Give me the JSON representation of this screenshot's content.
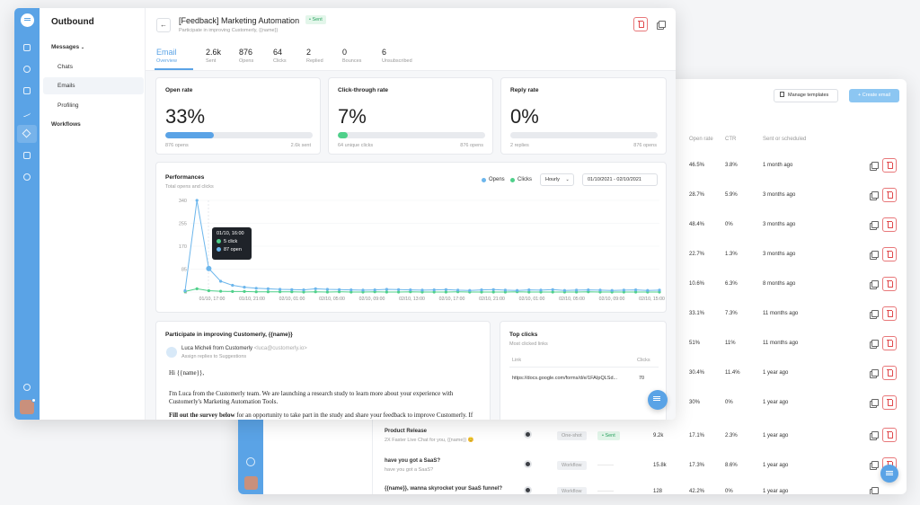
{
  "front": {
    "nav": {
      "title": "Outbound",
      "messages": "Messages",
      "chats": "Chats",
      "emails": "Emails",
      "profiling": "Profiling",
      "workflows": "Workflows"
    },
    "header": {
      "title": "[Feedback] Marketing Automation",
      "status": "• Sent",
      "subtitle": "Participate in improving Customerly, {{name}}",
      "back_icon": "←"
    },
    "tabs": [
      {
        "value": "Email",
        "label": "Overview"
      },
      {
        "value": "2.6k",
        "label": "Sent"
      },
      {
        "value": "876",
        "label": "Opens"
      },
      {
        "value": "64",
        "label": "Clicks"
      },
      {
        "value": "2",
        "label": "Replied"
      },
      {
        "value": "0",
        "label": "Bounces"
      },
      {
        "value": "6",
        "label": "Unsubscribed"
      }
    ],
    "stats": [
      {
        "title": "Open rate",
        "value": "33%",
        "progress": 0.33,
        "left": "876 opens",
        "right": "2.6k sent"
      },
      {
        "title": "Click-through rate",
        "value": "7%",
        "progress": 0.07,
        "left": "64 unique clicks",
        "right": "876 opens"
      },
      {
        "title": "Reply rate",
        "value": "0%",
        "progress": 0.0,
        "left": "2 replies",
        "right": "876 opens"
      }
    ],
    "performance": {
      "title": "Performances",
      "subtitle": "Total opens and clicks",
      "legend_opens": "Opens",
      "legend_clicks": "Clicks",
      "interval": "Hourly",
      "date_range": "01/10/2021 - 02/10/2021",
      "tooltip": {
        "title": "01/10, 16:00",
        "clicks": "5 click",
        "opens": "87 open"
      }
    },
    "email": {
      "subject": "Participate in improving Customerly, {{name}}",
      "from": "Luca Micheli from Customerly",
      "from_addr": "<luca@customerly.io>",
      "reply_note": "Assign replies to Suggestions",
      "greeting": "Hi {{name}},",
      "p1": "I'm Luca from the Customerly team. We are launching a research study to learn more about your experience with",
      "p1b": "Customerly's Marketing Automation Tools.",
      "p2_bold": "Fill out the survey below",
      "p2": " for an opportunity to take part in the study and share your feedback to improve Customerly. If you"
    },
    "top_clicks": {
      "title": "Top clicks",
      "subtitle": "Most clicked links",
      "col_link": "Link",
      "col_clicks": "Clicks",
      "rows": [
        {
          "link": "https://docs.google.com/forms/d/e/1FAIpQLSd...",
          "clicks": "70"
        }
      ]
    }
  },
  "back": {
    "manage_templates": "Manage templates",
    "create_email": "+ Create email",
    "columns": {
      "open_rate": "Open rate",
      "ctr": "CTR",
      "sent": "Sent or scheduled"
    },
    "rows": [
      {
        "open_rate": "46.5%",
        "ctr": "3.8%",
        "sent": "1 month ago"
      },
      {
        "open_rate": "28.7%",
        "ctr": "5.9%",
        "sent": "3 months ago"
      },
      {
        "open_rate": "48.4%",
        "ctr": "0%",
        "sent": "3 months ago"
      },
      {
        "open_rate": "22.7%",
        "ctr": "1.3%",
        "sent": "3 months ago"
      },
      {
        "open_rate": "10.6%",
        "ctr": "6.3%",
        "sent": "8 months ago"
      },
      {
        "open_rate": "33.1%",
        "ctr": "7.3%",
        "sent": "11 months ago"
      },
      {
        "open_rate": "51%",
        "ctr": "11%",
        "sent": "11 months ago"
      },
      {
        "open_rate": "30.4%",
        "ctr": "11.4%",
        "sent": "1 year ago"
      },
      {
        "open_rate": "30%",
        "ctr": "0%",
        "sent": "1 year ago"
      }
    ],
    "named_rows": [
      {
        "name": "Product Release",
        "sub": "2X Faster Live Chat for you, {{name}} 😊",
        "tag": "One-shot",
        "status": "• Sent",
        "sent_count": "9.2k",
        "open_rate": "17.1%",
        "ctr": "2.3%",
        "sent": "1 year ago"
      },
      {
        "name": "have you got a SaaS?",
        "sub": "have you got a SaaS?",
        "tag": "Workflow",
        "status": "———",
        "sent_count": "15.8k",
        "open_rate": "17.3%",
        "ctr": "8.6%",
        "sent": "1 year ago"
      },
      {
        "name": "{{name}}, wanna skyrocket your SaaS funnel?",
        "sub": "",
        "tag": "Workflow",
        "status": "———",
        "sent_count": "128",
        "open_rate": "42.2%",
        "ctr": "0%",
        "sent": "1 year ago"
      }
    ]
  }
}
